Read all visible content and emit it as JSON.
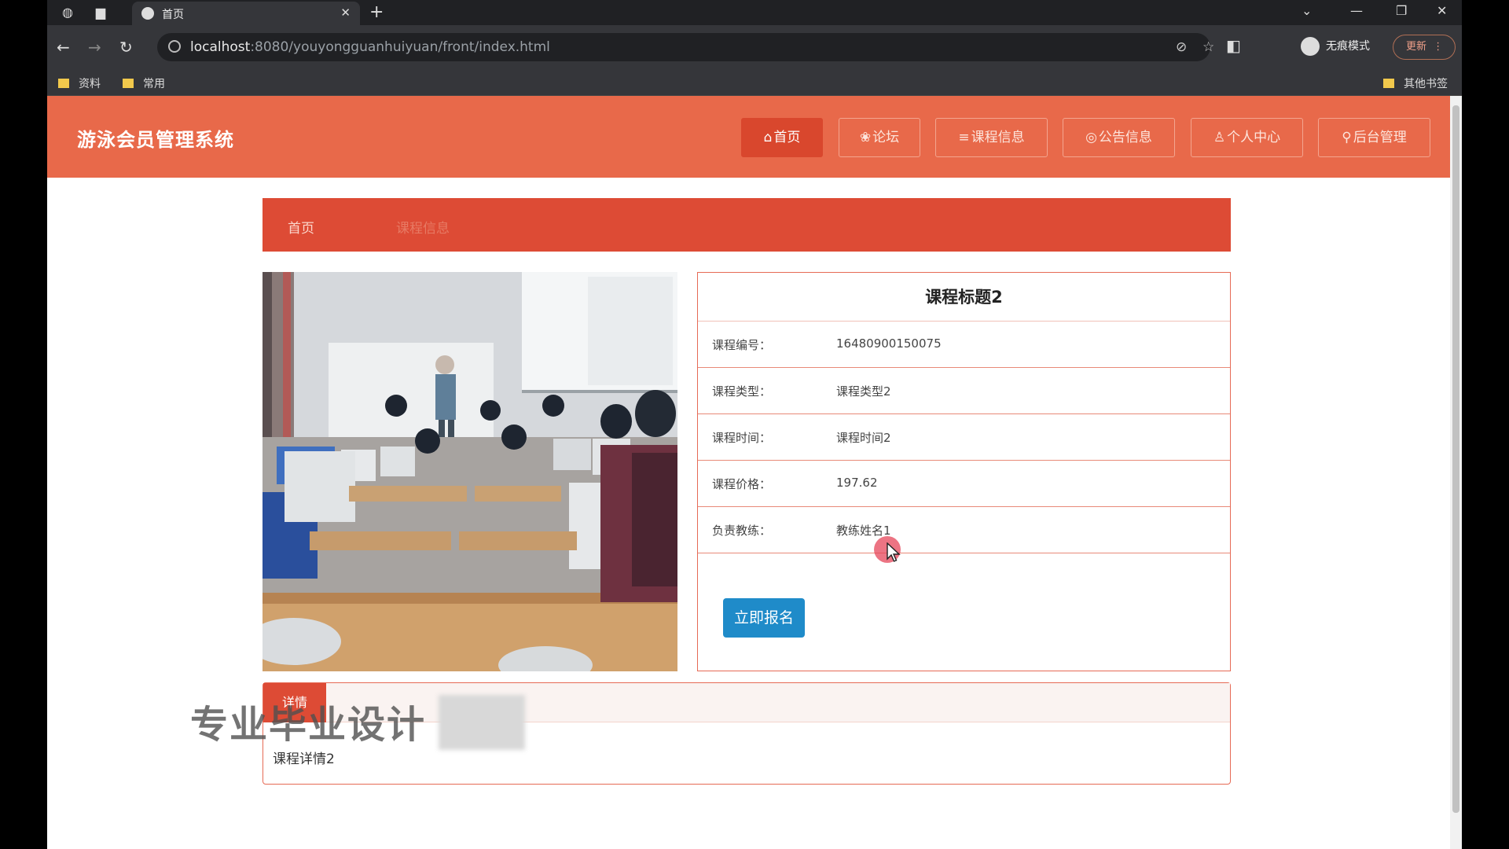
{
  "browser": {
    "tab_title": "首页",
    "url_host": "localhost",
    "url_rest": ":8080/youyongguanhuiyuan/front/index.html",
    "profile_label": "无痕模式",
    "update_label": "更新",
    "bookmarks": [
      "资料",
      "常用"
    ],
    "other_bookmarks": "其他书签"
  },
  "header": {
    "site_title": "游泳会员管理系统",
    "nav": [
      {
        "icon": "⌂",
        "label": "首页",
        "active": true
      },
      {
        "icon": "❀",
        "label": "论坛",
        "active": false
      },
      {
        "icon": "≡",
        "label": "课程信息",
        "active": false
      },
      {
        "icon": "◎",
        "label": "公告信息",
        "active": false
      },
      {
        "icon": "♙",
        "label": "个人中心",
        "active": false
      },
      {
        "icon": "⚲",
        "label": "后台管理",
        "active": false
      }
    ]
  },
  "breadcrumb": {
    "home": "首页",
    "current": "课程信息"
  },
  "course": {
    "title": "课程标题2",
    "rows": [
      {
        "key": "课程编号：",
        "value": "16480900150075"
      },
      {
        "key": "课程类型：",
        "value": "课程类型2"
      },
      {
        "key": "课程时间：",
        "value": "课程时间2"
      },
      {
        "key": "课程价格：",
        "value": "197.62"
      },
      {
        "key": "负责教练：",
        "value": "教练姓名1"
      }
    ],
    "enroll_label": "立即报名"
  },
  "detail": {
    "tab_label": "详情",
    "text": "课程详情2"
  },
  "watermark": "专业毕业设计",
  "colors": {
    "header": "#e8694a",
    "accent": "#dd4b35",
    "enroll_button": "#1f8bc9"
  }
}
